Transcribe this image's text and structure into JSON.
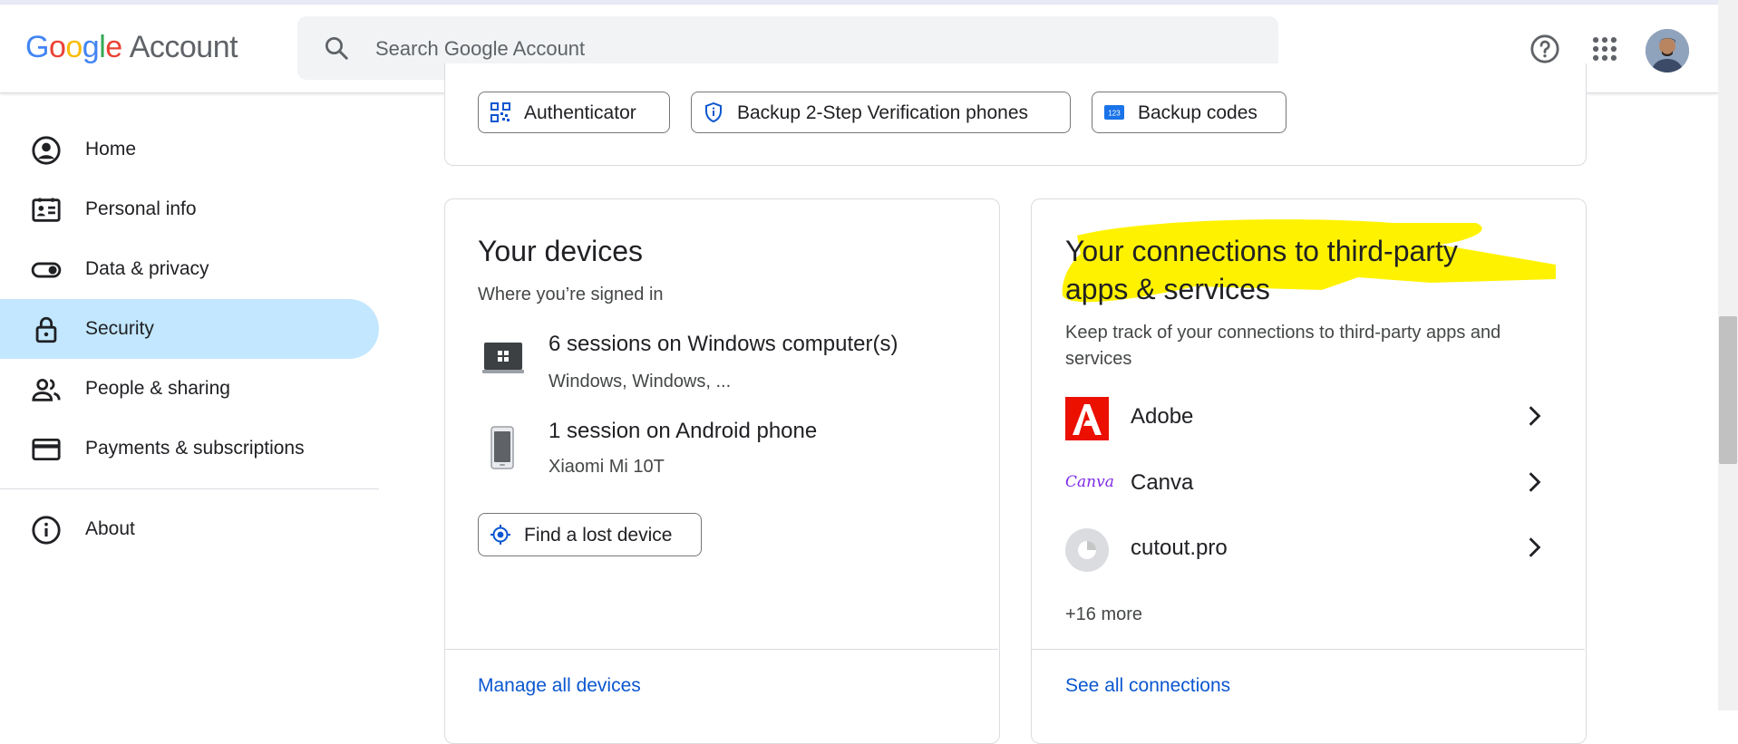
{
  "header": {
    "logo_word": "Google",
    "logo_suffix": "Account",
    "search_placeholder": "Search Google Account",
    "help_icon": "help-circle-icon",
    "apps_icon": "apps-grid-icon"
  },
  "sidebar": {
    "items": [
      {
        "label": "Home",
        "icon": "account-circle-icon"
      },
      {
        "label": "Personal info",
        "icon": "id-card-icon"
      },
      {
        "label": "Data & privacy",
        "icon": "toggle-icon"
      },
      {
        "label": "Security",
        "icon": "lock-icon",
        "active": true
      },
      {
        "label": "People & sharing",
        "icon": "people-icon"
      },
      {
        "label": "Payments & subscriptions",
        "icon": "credit-card-icon"
      },
      {
        "label": "About",
        "icon": "info-icon"
      }
    ]
  },
  "two_step": {
    "chips": [
      {
        "label": "Authenticator",
        "icon": "qr-code-icon"
      },
      {
        "label": "Backup 2-Step Verification phones",
        "icon": "shield-icon"
      },
      {
        "label": "Backup codes",
        "icon": "backup-codes-icon"
      }
    ]
  },
  "devices": {
    "title": "Your devices",
    "subtitle": "Where you’re signed in",
    "entries": [
      {
        "title": "6 sessions on Windows computer(s)",
        "detail": "Windows, Windows, ...",
        "icon": "laptop-icon"
      },
      {
        "title": "1 session on Android phone",
        "detail": "Xiaomi Mi 10T",
        "icon": "phone-icon"
      }
    ],
    "find_button": "Find a lost device",
    "manage_link": "Manage all devices"
  },
  "connections": {
    "title_line1": "Your connections to third-party",
    "title_line2": "apps & services",
    "description_line1": "Keep track of your connections to third-party apps and",
    "description_line2": "services",
    "apps": [
      {
        "name": "Adobe",
        "icon": "adobe-logo-icon"
      },
      {
        "name": "Canva",
        "icon": "canva-logo-icon",
        "logo_text": "Canva"
      },
      {
        "name": "cutout.pro",
        "icon": "cutout-pro-logo-icon"
      }
    ],
    "more": "+16 more",
    "see_all_link": "See all connections"
  },
  "colors": {
    "accent": "#0b57d0",
    "active_nav": "#c2e7ff",
    "highlight": "#fff200",
    "border": "#dadce0"
  }
}
